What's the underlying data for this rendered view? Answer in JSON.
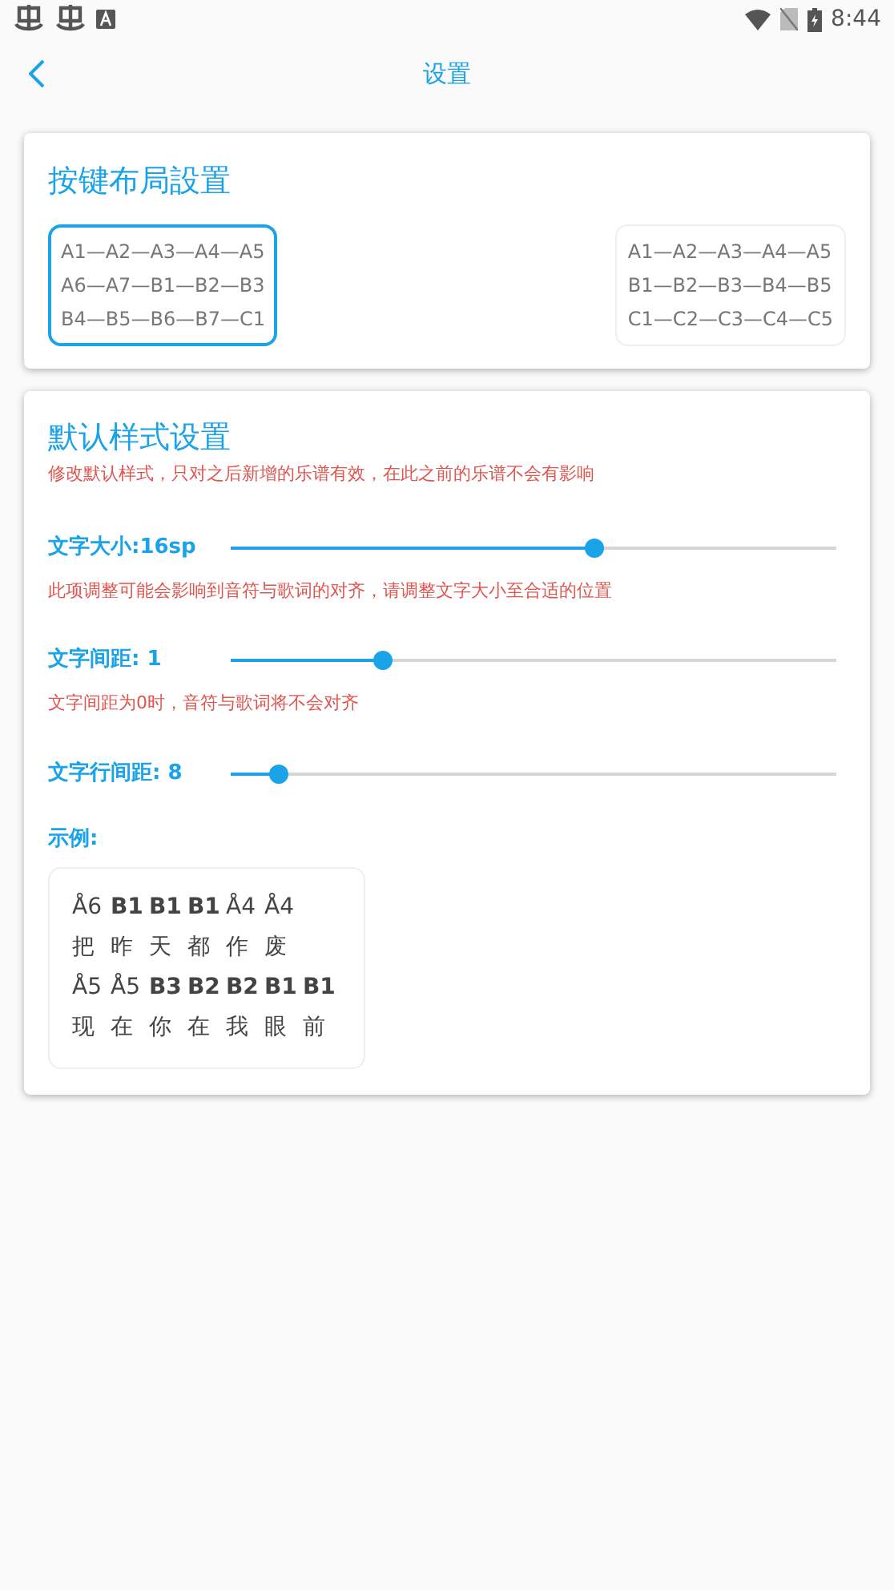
{
  "status_bar": {
    "time": "8:44"
  },
  "header": {
    "title": "设置"
  },
  "layout_section": {
    "title": "按键布局設置",
    "options": [
      {
        "selected": true,
        "lines": [
          "A1—A2—A3—A4—A5",
          "A6—A7—B1—B2—B3",
          "B4—B5—B6—B7—C1"
        ]
      },
      {
        "selected": false,
        "lines": [
          "A1—A2—A3—A4—A5",
          "B1—B2—B3—B4—B5",
          "C1—C2—C3—C4—C5"
        ]
      }
    ]
  },
  "style_section": {
    "title": "默认样式设置",
    "note": "修改默认样式，只对之后新增的乐谱有效，在此之前的乐谱不会有影响",
    "sliders": [
      {
        "label": "文字大小:16sp",
        "level": 0.6,
        "hint": "此项调整可能会影响到音符与歌词的对齐，请调整文字大小至合适的位置"
      },
      {
        "label": "文字间距: 1",
        "level": 0.25,
        "hint": "文字间距为0时，音符与歌词将不会对齐"
      },
      {
        "label": "文字行间距: 8",
        "level": 0.08
      }
    ],
    "example_label": "示例:",
    "example_lines": [
      {
        "tokens": [
          {
            "text": "Å6",
            "bold": false
          },
          {
            "text": "B1",
            "bold": true
          },
          {
            "text": "B1",
            "bold": true
          },
          {
            "text": "B1",
            "bold": true
          },
          {
            "text": "Å4",
            "bold": false
          },
          {
            "text": "Å4",
            "bold": false
          }
        ]
      },
      {
        "tokens": [
          {
            "text": "把",
            "bold": false
          },
          {
            "text": "昨",
            "bold": false
          },
          {
            "text": "天",
            "bold": false
          },
          {
            "text": "都",
            "bold": false
          },
          {
            "text": "作",
            "bold": false
          },
          {
            "text": "废",
            "bold": false
          }
        ]
      },
      {
        "tokens": [
          {
            "text": "Å5",
            "bold": false
          },
          {
            "text": "Å5",
            "bold": false
          },
          {
            "text": "B3",
            "bold": true
          },
          {
            "text": "B2",
            "bold": true
          },
          {
            "text": "B2",
            "bold": true
          },
          {
            "text": "B1",
            "bold": true
          },
          {
            "text": "B1",
            "bold": true
          }
        ]
      },
      {
        "tokens": [
          {
            "text": "现",
            "bold": false
          },
          {
            "text": "在",
            "bold": false
          },
          {
            "text": "你",
            "bold": false
          },
          {
            "text": "在",
            "bold": false
          },
          {
            "text": "我",
            "bold": false
          },
          {
            "text": "眼",
            "bold": false
          },
          {
            "text": "前",
            "bold": false
          }
        ]
      }
    ]
  }
}
